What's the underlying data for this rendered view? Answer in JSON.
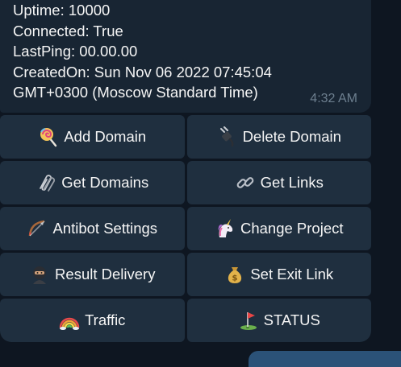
{
  "message": {
    "lines": [
      "Uptime: 10000",
      "Connected: True",
      "LastPing: 00.00.00",
      "CreatedOn: Sun Nov 06 2022 07:45:04",
      "GMT+0300 (Moscow Standard Time)"
    ],
    "time": "4:32 AM"
  },
  "keyboard": {
    "rows": [
      [
        {
          "label": "Add Domain",
          "icon": "lollipop-icon"
        },
        {
          "label": "Delete Domain",
          "icon": "plug-icon"
        }
      ],
      [
        {
          "label": "Get Domains",
          "icon": "paperclips-icon"
        },
        {
          "label": "Get Links",
          "icon": "link-icon"
        }
      ],
      [
        {
          "label": "Antibot Settings",
          "icon": "bow-and-arrow-icon"
        },
        {
          "label": "Change Project",
          "icon": "unicorn-icon"
        }
      ],
      [
        {
          "label": "Result Delivery",
          "icon": "ninja-icon"
        },
        {
          "label": "Set Exit Link",
          "icon": "money-bag-icon"
        }
      ],
      [
        {
          "label": "Traffic",
          "icon": "rainbow-icon"
        },
        {
          "label": "STATUS",
          "icon": "golf-flag-icon"
        }
      ]
    ]
  },
  "colors": {
    "background": "#0e1621",
    "bubble": "#182533",
    "button": "#1f2f3f",
    "text": "#f5f5f5",
    "time": "#6d7f8f"
  }
}
